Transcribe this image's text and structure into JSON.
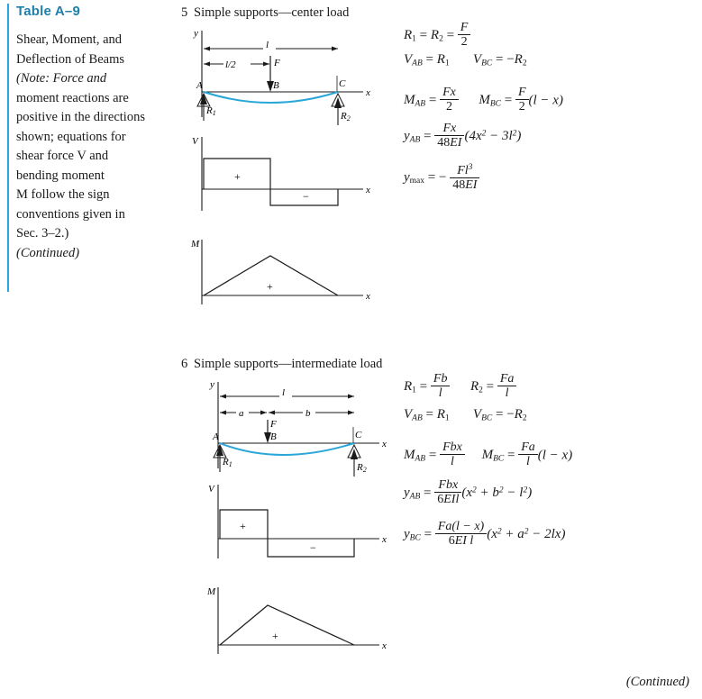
{
  "document": {
    "table_title": "Table A–9",
    "left_paragraph_lines": [
      "Shear, Moment, and",
      "Deflection of Beams",
      "(Note: Force and",
      "moment reactions are",
      "positive in the directions",
      "shown; equations for",
      "shear force V and",
      "bending moment",
      "M follow the sign",
      "conventions given in",
      "Sec. 3–2.)",
      "(Continued)"
    ],
    "footer_note": "(Continued)"
  },
  "sections": [
    {
      "number": "5",
      "title": "Simple supports—center load",
      "diagram": {
        "axis_y_label": "y",
        "axis_x_label": "x",
        "axis_v_label": "V",
        "axis_m_label": "M",
        "span_label": "l",
        "half_span_label": "l/2",
        "force_label": "F",
        "points": [
          "A",
          "B",
          "C"
        ],
        "reactions": [
          "R₁",
          "R₂"
        ],
        "shear_signs": [
          "+",
          "−"
        ],
        "moment_sign": "+"
      },
      "equations": [
        "R₁ = R₂ = F/2",
        "V_AB = R₁     V_BC = −R₂",
        "M_AB = Fx/2     M_BC = (F/2)(l − x)",
        "y_AB = Fx/(48EI) (4x² − 3l²)",
        "y_max = − Fl³/(48EI)"
      ]
    },
    {
      "number": "6",
      "title": "Simple supports—intermediate load",
      "diagram": {
        "axis_y_label": "y",
        "axis_x_label": "x",
        "axis_v_label": "V",
        "axis_m_label": "M",
        "span_label": "l",
        "segment_labels": [
          "a",
          "b"
        ],
        "force_label": "F",
        "points": [
          "A",
          "B",
          "C"
        ],
        "reactions": [
          "R₁",
          "R₂"
        ],
        "shear_signs": [
          "+",
          "−"
        ],
        "moment_sign": "+"
      },
      "equations": [
        "R₁ = Fb/l     R₂ = Fa/l",
        "V_AB = R₁     V_BC = −R₂",
        "M_AB = Fbx/l     M_BC = (Fa/l)(l − x)",
        "y_AB = Fbx/(6EIl) (x² + b² − l²)",
        "y_BC = Fa(l − x)/(6EIl) (x² + a² − 2lx)"
      ]
    }
  ],
  "colors": {
    "accent": "#1f7fa8",
    "rule": "#2aa7d8",
    "beam": "#2aa7d8",
    "ink": "#1a1a1a"
  }
}
